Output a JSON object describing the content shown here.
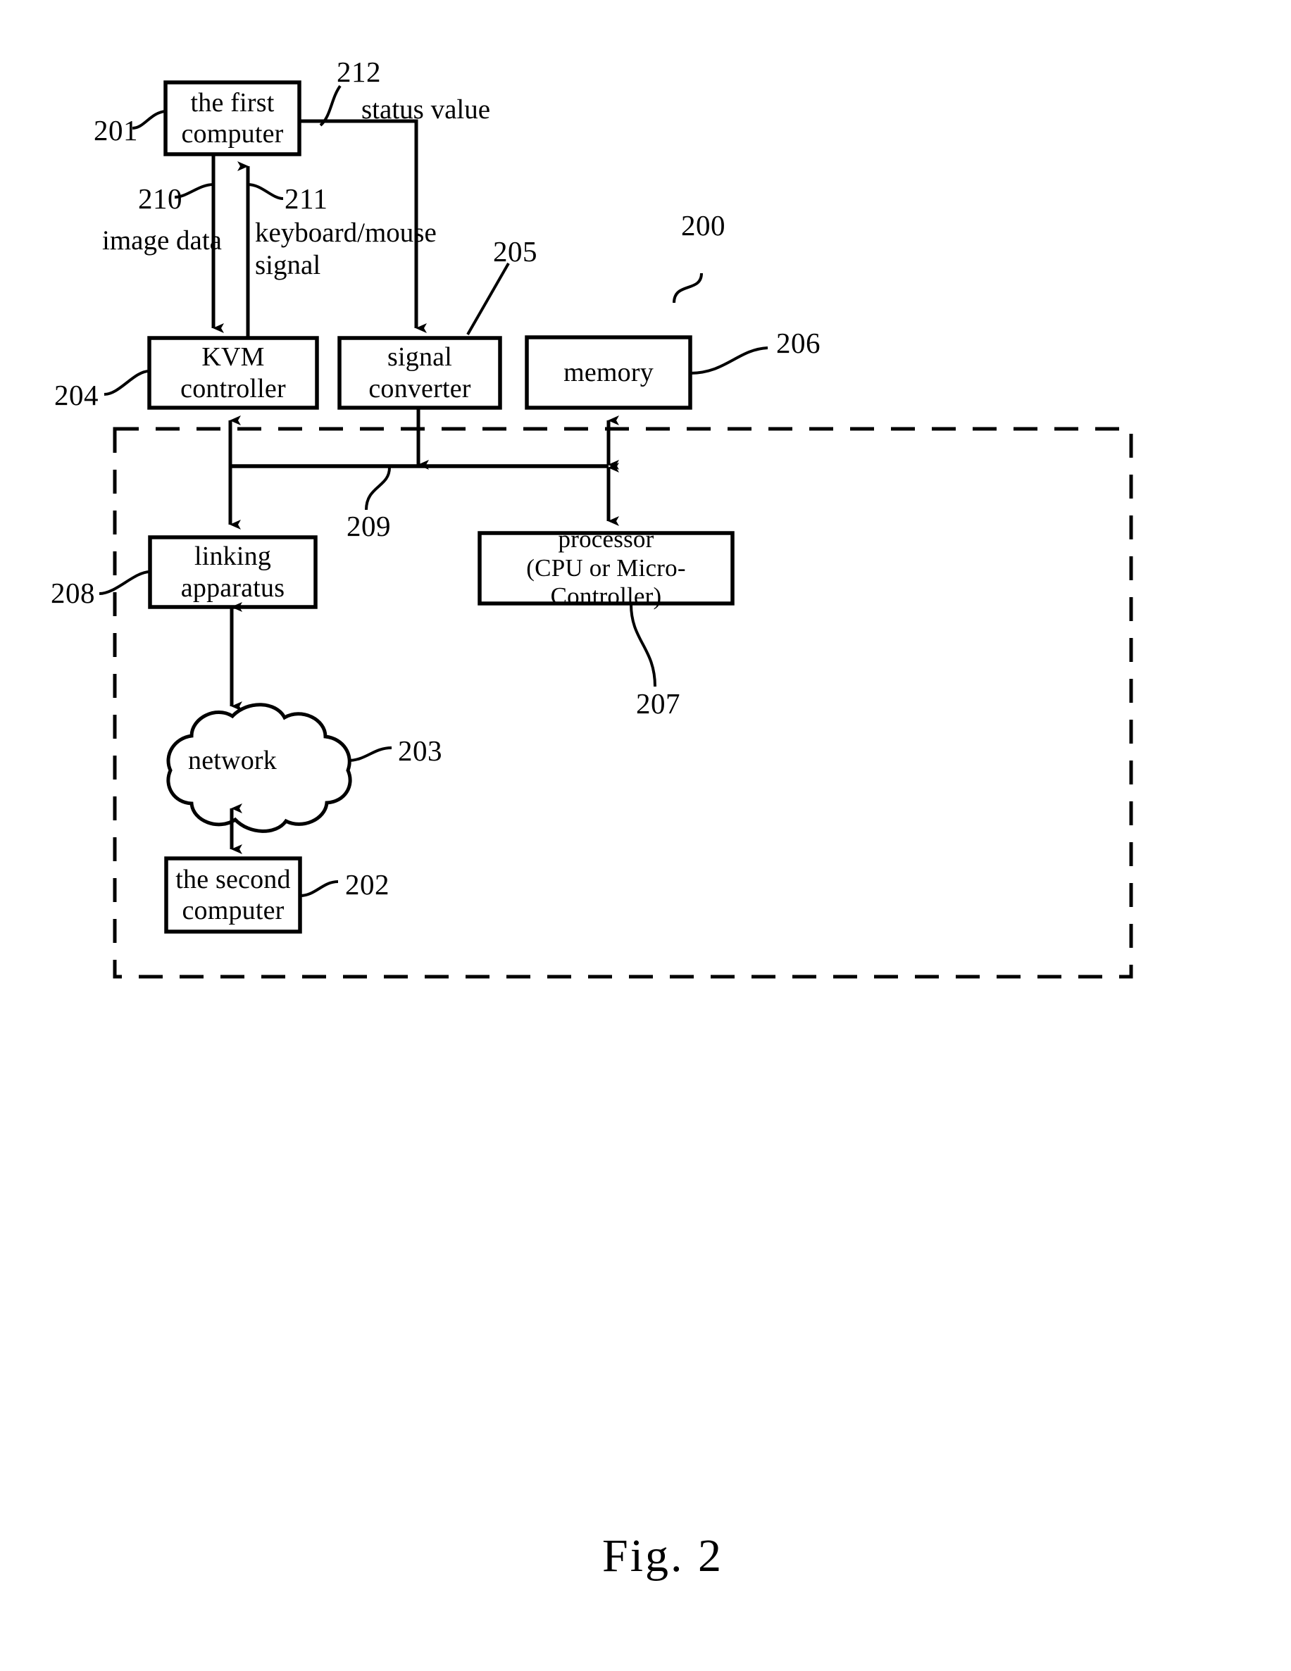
{
  "figure": {
    "caption": "Fig. 2",
    "number": "2"
  },
  "boxes": [
    {
      "id": "first-computer",
      "label": "the first\ncomputer",
      "ref": "201"
    },
    {
      "id": "kvm-controller",
      "label": "KVM controller",
      "ref": "204"
    },
    {
      "id": "signal-converter",
      "label": "signal\nconverter",
      "ref": "205"
    },
    {
      "id": "memory",
      "label": "memory",
      "ref": "206"
    },
    {
      "id": "linking-apparatus",
      "label": "linking\napparatus",
      "ref": "208"
    },
    {
      "id": "processor",
      "label": "processor\n(CPU or Micro-Controller)",
      "ref": "207"
    },
    {
      "id": "network",
      "label": "network",
      "ref": "203"
    },
    {
      "id": "second-computer",
      "label": "the second\ncomputer",
      "ref": "202"
    }
  ],
  "signals": [
    {
      "id": "image-data",
      "label": "image data",
      "ref": "210"
    },
    {
      "id": "keyboard-mouse-signal",
      "label": "keyboard/mouse\nsignal",
      "ref": "211"
    },
    {
      "id": "status-value",
      "label": "status value",
      "ref": "212"
    }
  ],
  "system": {
    "ref": "200",
    "bus_ref": "209"
  },
  "refs": {
    "r200": "200",
    "r201": "201",
    "r202": "202",
    "r203": "203",
    "r204": "204",
    "r205": "205",
    "r206": "206",
    "r207": "207",
    "r208": "208",
    "r209": "209",
    "r210": "210",
    "r211": "211",
    "r212": "212"
  },
  "labels": {
    "first_computer": "the first\ncomputer",
    "second_computer": "the second\ncomputer",
    "kvm_controller": "KVM controller",
    "signal_converter": "signal\nconverter",
    "memory": "memory",
    "linking_apparatus": "linking\napparatus",
    "processor": "processor\n(CPU or Micro-Controller)",
    "network": "network",
    "image_data": "image data",
    "keyboard_mouse_signal": "keyboard/mouse\nsignal",
    "status_value": "status value",
    "fig_caption": "Fig.  2"
  },
  "colors": {
    "stroke": "#000000",
    "background": "#ffffff"
  }
}
